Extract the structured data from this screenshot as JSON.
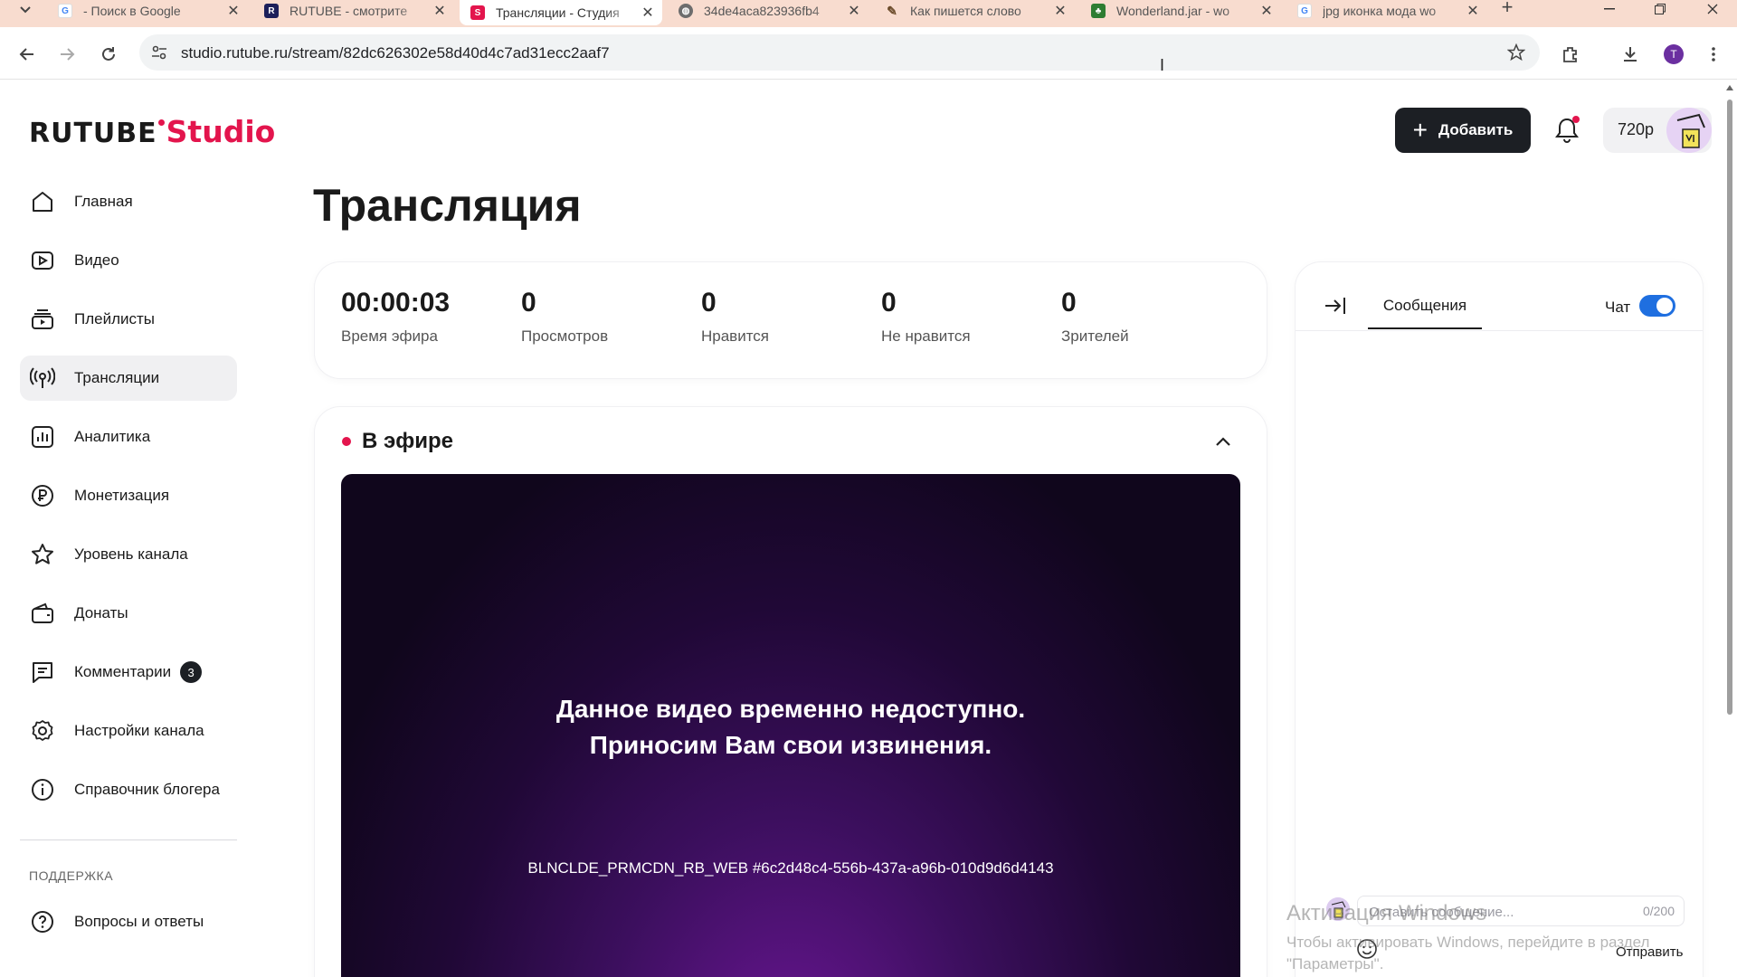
{
  "browser": {
    "tabs": [
      {
        "label": "- Поиск в Google",
        "icon": "google-icon",
        "active": false
      },
      {
        "label": "RUTUBE - смотрите",
        "icon": "rutube-icon",
        "active": false
      },
      {
        "label": "Трансляции - Студия",
        "icon": "rutube-studio-icon",
        "active": true
      },
      {
        "label": "34de4aca823936fb4",
        "icon": "globe-icon",
        "active": false
      },
      {
        "label": "Как пишется слово",
        "icon": "pen-icon",
        "active": false
      },
      {
        "label": "Wonderland.jar - wo",
        "icon": "tree-icon",
        "active": false
      },
      {
        "label": "jpg иконка мода wo",
        "icon": "google-icon",
        "active": false
      }
    ],
    "new_tab": "+",
    "url": "studio.rutube.ru/stream/82dc626302e58d40d4c7ad31ecc2aaf7",
    "profile_initial": "T"
  },
  "header": {
    "logo_main": "RUTUBE",
    "logo_studio": "Studio",
    "add_label": "Добавить",
    "quality": "720p"
  },
  "sidebar": {
    "items": [
      {
        "label": "Главная",
        "icon": "home-icon"
      },
      {
        "label": "Видео",
        "icon": "video-icon"
      },
      {
        "label": "Плейлисты",
        "icon": "playlist-icon"
      },
      {
        "label": "Трансляции",
        "icon": "broadcast-icon",
        "active": true
      },
      {
        "label": "Аналитика",
        "icon": "analytics-icon"
      },
      {
        "label": "Монетизация",
        "icon": "ruble-icon"
      },
      {
        "label": "Уровень канала",
        "icon": "star-icon"
      },
      {
        "label": "Донаты",
        "icon": "wallet-icon"
      },
      {
        "label": "Комментарии",
        "icon": "comment-icon",
        "count": "3"
      },
      {
        "label": "Настройки канала",
        "icon": "gear-icon"
      },
      {
        "label": "Справочник блогера",
        "icon": "info-icon"
      }
    ],
    "support_heading": "ПОДДЕРЖКА",
    "support_items": [
      {
        "label": "Вопросы и ответы",
        "icon": "question-icon"
      }
    ]
  },
  "main": {
    "title": "Трансляция",
    "stats": [
      {
        "value": "00:00:03",
        "label": "Время эфира"
      },
      {
        "value": "0",
        "label": "Просмотров"
      },
      {
        "value": "0",
        "label": "Нравится"
      },
      {
        "value": "0",
        "label": "Не нравится"
      },
      {
        "value": "0",
        "label": "Зрителей"
      }
    ],
    "live": {
      "title": "В эфире",
      "message_line1": "Данное видео временно недоступно.",
      "message_line2": "Приносим Вам свои извинения.",
      "error_code": "BLNCLDE_PRMCDN_RB_WEB #6c2d48c4-556b-437a-a96b-010d9d6d4143"
    }
  },
  "chat": {
    "tab_label": "Сообщения",
    "toggle_label": "Чат",
    "toggle_on": true,
    "input_placeholder": "Оставить сообщение...",
    "counter": "0/200",
    "send_label": "Отправить"
  },
  "os_overlay": {
    "line1": "Активация Windows",
    "line2": "Чтобы активировать Windows, перейдите в раздел",
    "line3": "\"Параметры\"."
  },
  "colors": {
    "accent": "#e3154d",
    "button_dark": "#1c1f24",
    "toggle": "#1f6fe0",
    "tabbar": "#f8dccf"
  }
}
